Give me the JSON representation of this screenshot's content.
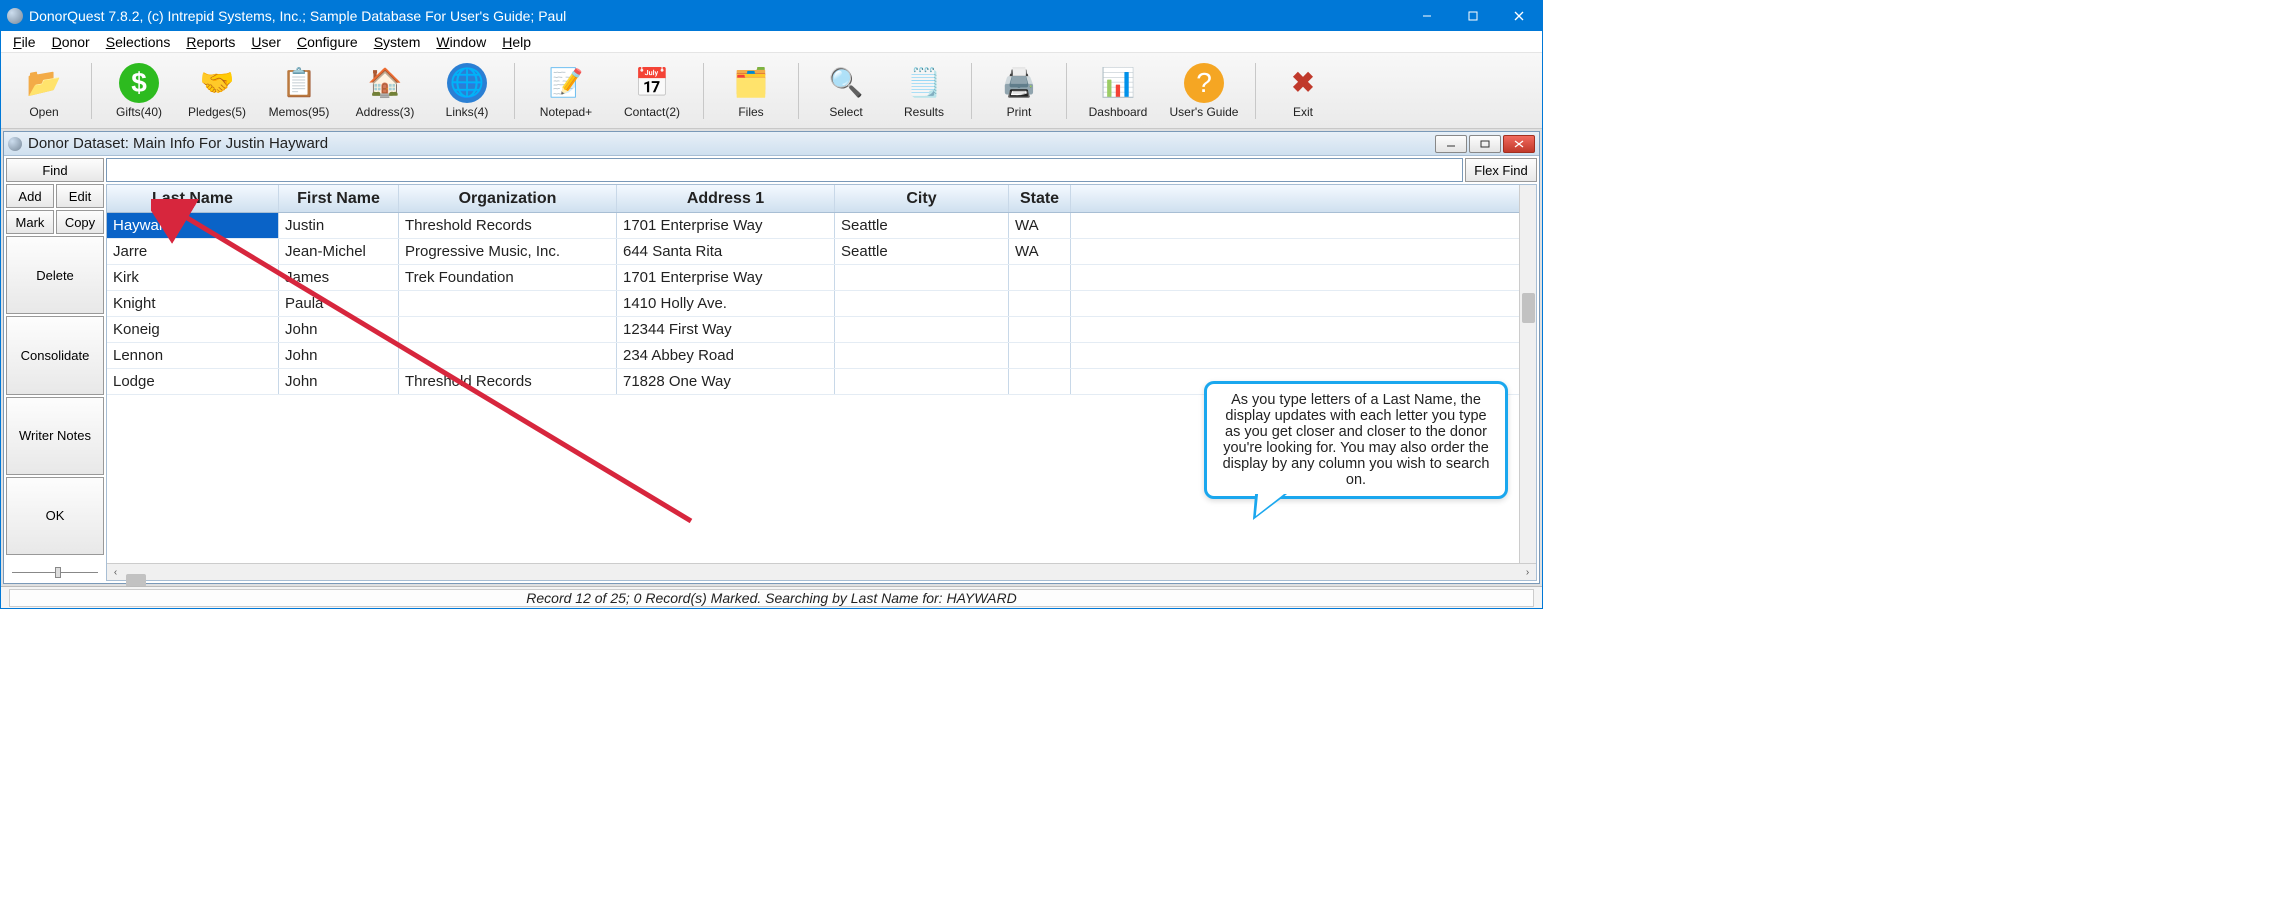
{
  "titlebar": {
    "title": "DonorQuest 7.8.2, (c) Intrepid Systems, Inc.; Sample Database For User's Guide; Paul"
  },
  "menus": [
    "File",
    "Donor",
    "Selections",
    "Reports",
    "User",
    "Configure",
    "System",
    "Window",
    "Help"
  ],
  "toolbar": [
    {
      "name": "open",
      "label": "Open"
    },
    {
      "name": "gifts",
      "label": "Gifts(40)"
    },
    {
      "name": "pledges",
      "label": "Pledges(5)"
    },
    {
      "name": "memos",
      "label": "Memos(95)"
    },
    {
      "name": "address",
      "label": "Address(3)"
    },
    {
      "name": "links",
      "label": "Links(4)"
    },
    {
      "name": "notepad",
      "label": "Notepad+"
    },
    {
      "name": "contact",
      "label": "Contact(2)"
    },
    {
      "name": "files",
      "label": "Files"
    },
    {
      "name": "select",
      "label": "Select"
    },
    {
      "name": "results",
      "label": "Results"
    },
    {
      "name": "print",
      "label": "Print"
    },
    {
      "name": "dashboard",
      "label": "Dashboard"
    },
    {
      "name": "users-guide",
      "label": "User's Guide"
    },
    {
      "name": "exit",
      "label": "Exit"
    }
  ],
  "child": {
    "title": "Donor Dataset: Main Info For Justin Hayward",
    "side_buttons": {
      "find": "Find",
      "add": "Add",
      "edit": "Edit",
      "mark": "Mark",
      "copy": "Copy",
      "delete": "Delete",
      "consolidate": "Consolidate",
      "writer_notes": "Writer Notes",
      "ok": "OK"
    },
    "flex_find": "Flex Find",
    "columns": [
      "Last Name",
      "First Name",
      "Organization",
      "Address 1",
      "City",
      "State"
    ],
    "rows": [
      {
        "last": "Hayward",
        "first": "Justin",
        "org": "Threshold Records",
        "addr": "1701 Enterprise Way",
        "city": "Seattle",
        "state": "WA",
        "selected": true
      },
      {
        "last": "Jarre",
        "first": "Jean-Michel",
        "org": "Progressive Music, Inc.",
        "addr": "644 Santa Rita",
        "city": "Seattle",
        "state": "WA"
      },
      {
        "last": "Kirk",
        "first": "James",
        "org": "Trek Foundation",
        "addr": "1701 Enterprise Way",
        "city": "",
        "state": ""
      },
      {
        "last": "Knight",
        "first": "Paula",
        "org": "",
        "addr": "1410 Holly Ave.",
        "city": "",
        "state": ""
      },
      {
        "last": "Koneig",
        "first": "John",
        "org": "",
        "addr": "12344 First Way",
        "city": "",
        "state": ""
      },
      {
        "last": "Lennon",
        "first": "John",
        "org": "",
        "addr": "234 Abbey Road",
        "city": "",
        "state": ""
      },
      {
        "last": "Lodge",
        "first": "John",
        "org": "Threshold Records",
        "addr": "71828 One Way",
        "city": "",
        "state": ""
      }
    ]
  },
  "callout": {
    "text": "As you type letters of a Last Name, the display updates with each letter you type as you get closer and closer to the donor you're looking for. You may also order the display by any column you wish to search on."
  },
  "status": {
    "text": "Record 12 of 25; 0 Record(s) Marked.  Searching by Last Name for: HAYWARD"
  }
}
